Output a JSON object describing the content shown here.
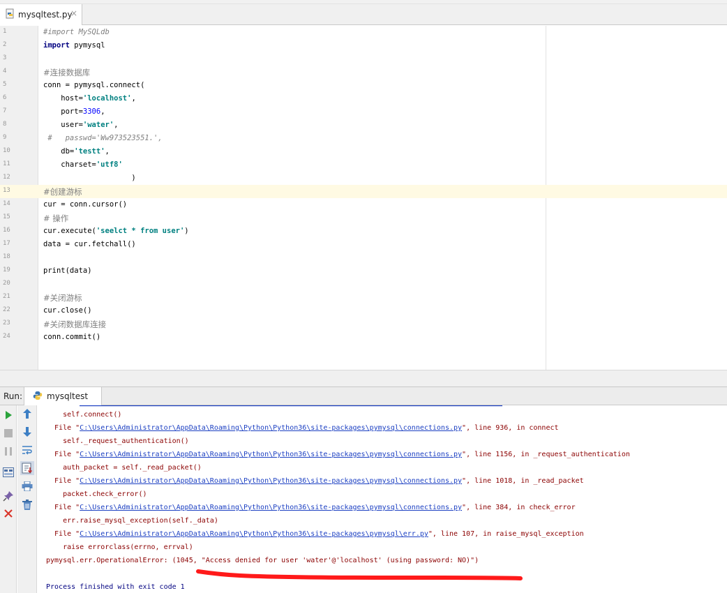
{
  "editor_tab": {
    "file_name": "mysqltest.py",
    "close_glyph": "×"
  },
  "code": {
    "current_line": "13",
    "lines": [
      {
        "no": "1",
        "text": "#import MySQLdb"
      },
      {
        "no": "2",
        "text": "import pymysql"
      },
      {
        "no": "3",
        "text": ""
      },
      {
        "no": "4",
        "text": "#连接数据库"
      },
      {
        "no": "5",
        "text": "conn = pymysql.connect("
      },
      {
        "no": "6",
        "text": "    host='localhost',"
      },
      {
        "no": "7",
        "text": "    port=3306,"
      },
      {
        "no": "8",
        "text": "    user='water',"
      },
      {
        "no": "9",
        "text": " #   passwd='Ww973523551.',"
      },
      {
        "no": "10",
        "text": "    db='testt',"
      },
      {
        "no": "11",
        "text": "    charset='utf8'"
      },
      {
        "no": "12",
        "text": "                    )"
      },
      {
        "no": "13",
        "text": "#创建游标"
      },
      {
        "no": "14",
        "text": "cur = conn.cursor()"
      },
      {
        "no": "15",
        "text": "# 操作"
      },
      {
        "no": "16",
        "text": "cur.execute('seelct * from user')"
      },
      {
        "no": "17",
        "text": "data = cur.fetchall()"
      },
      {
        "no": "18",
        "text": ""
      },
      {
        "no": "19",
        "text": "print(data)"
      },
      {
        "no": "20",
        "text": ""
      },
      {
        "no": "21",
        "text": "#关闭游标"
      },
      {
        "no": "22",
        "text": "cur.close()"
      },
      {
        "no": "23",
        "text": "#关闭数据库连接"
      },
      {
        "no": "24",
        "text": "conn.commit()"
      }
    ],
    "segments": {
      "l1_cmt": "#import MySQLdb",
      "l2_kw": "import",
      "l2_rest": " pymysql",
      "l4_cmt": "#连接数据库",
      "l5": "conn = pymysql.connect(",
      "l6_a": "    host=",
      "l6_s": "'localhost'",
      "l6_b": ",",
      "l7_a": "    port=",
      "l7_n": "3306",
      "l7_b": ",",
      "l8_a": "    user=",
      "l8_s": "'water'",
      "l8_b": ",",
      "l9_cmt": " #   passwd='Ww973523551.',",
      "l10_a": "    db=",
      "l10_s": "'testt'",
      "l10_b": ",",
      "l11_a": "    charset=",
      "l11_s": "'utf8'",
      "l12": "                    )",
      "l13_cmt": "#创建游标",
      "l14": "cur = conn.cursor()",
      "l15_cmt": "# 操作",
      "l16_a": "cur.execute(",
      "l16_s": "'seelct * from user'",
      "l16_b": ")",
      "l17": "data = cur.fetchall()",
      "l19": "print(data)",
      "l21_cmt": "#关闭游标",
      "l22": "cur.close()",
      "l23_cmt": "#关闭数据库连接",
      "l24": "conn.commit()"
    }
  },
  "run_panel": {
    "label": "Run:",
    "tab_label": "mysqltest",
    "console": {
      "t0": "    self.connect()",
      "f1_a": "  File \"",
      "f1_path": "C:\\Users\\Administrator\\AppData\\Roaming\\Python\\Python36\\site-packages\\pymysql\\connections.py",
      "f1_b": "\", line 936, in connect",
      "t1": "    self._request_authentication()",
      "f2_a": "  File \"",
      "f2_path": "C:\\Users\\Administrator\\AppData\\Roaming\\Python\\Python36\\site-packages\\pymysql\\connections.py",
      "f2_b": "\", line 1156, in _request_authentication",
      "t2": "    auth_packet = self._read_packet()",
      "f3_a": "  File \"",
      "f3_path": "C:\\Users\\Administrator\\AppData\\Roaming\\Python\\Python36\\site-packages\\pymysql\\connections.py",
      "f3_b": "\", line 1018, in _read_packet",
      "t3": "    packet.check_error()",
      "f4_a": "  File \"",
      "f4_path": "C:\\Users\\Administrator\\AppData\\Roaming\\Python\\Python36\\site-packages\\pymysql\\connections.py",
      "f4_b": "\", line 384, in check_error",
      "t4": "    err.raise_mysql_exception(self._data)",
      "f5_a": "  File \"",
      "f5_path": "C:\\Users\\Administrator\\AppData\\Roaming\\Python\\Python36\\site-packages\\pymysql\\err.py",
      "f5_b": "\", line 107, in raise_mysql_exception",
      "t5": "    raise errorclass(errno, errval)",
      "error": "pymysql.err.OperationalError: (1045, \"Access denied for user 'water'@'localhost' (using password: NO)\")",
      "process": "Process finished with exit code 1"
    }
  },
  "colors": {
    "keyword": "#000080",
    "string": "#008080",
    "number": "#0000ff",
    "comment": "#808080",
    "error_text": "#8b0000",
    "link": "#1b3fc2",
    "annotation": "#ff0000",
    "current_line_bg": "#fffae3"
  },
  "icons": {
    "tab_file": "python-file-icon",
    "run_tab": "python-icon",
    "tools_left": [
      "rerun-icon",
      "stop-icon",
      "pause-icon",
      "layout-icon",
      "pin-icon",
      "close-icon"
    ],
    "tools_mid": [
      "up-arrow-icon",
      "down-arrow-icon",
      "soft-wrap-icon",
      "scroll-to-end-icon",
      "print-icon",
      "trash-icon"
    ]
  }
}
